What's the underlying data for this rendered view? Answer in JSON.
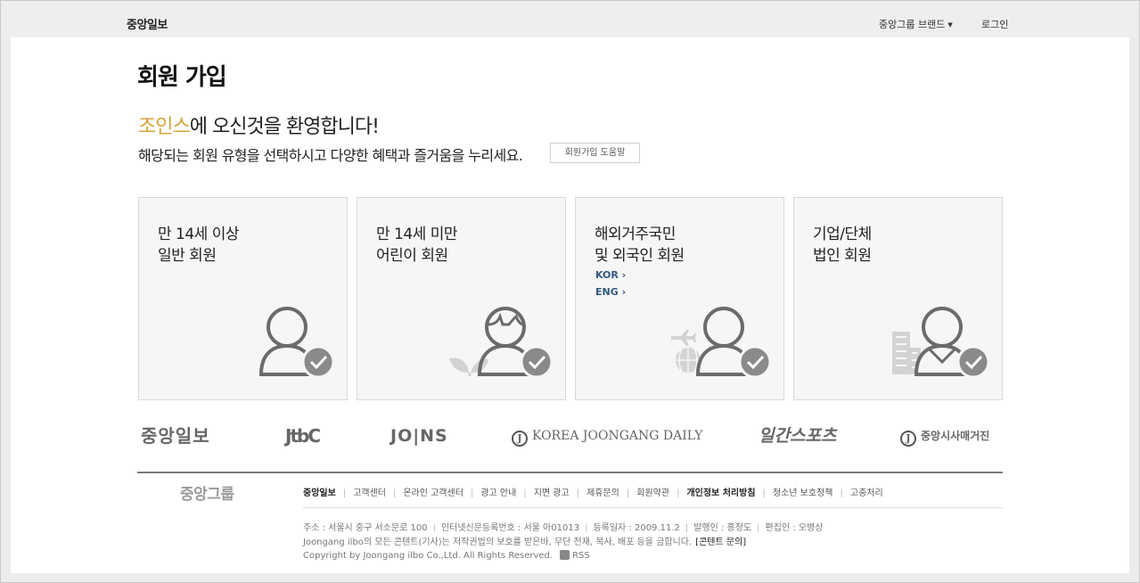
{
  "header": {
    "logo": "중앙일보",
    "brand_menu_label": "중앙그룹 브랜드",
    "login_label": "로그인"
  },
  "page": {
    "title": "회원 가입",
    "welcome_brand": "조인스",
    "welcome_rest": "에 오신것을 환영합니다!",
    "subtitle": "해당되는 회원 유형을 선택하시고 다양한 혜택과 즐거움을 누리세요.",
    "help_button": "회원가입 도움말"
  },
  "cards": [
    {
      "line1": "만 14세 이상",
      "line2": "일반 회원"
    },
    {
      "line1": "만 14세 미만",
      "line2": "어린이 회원"
    },
    {
      "line1": "해외거주국민",
      "line2": "및 외국인 회원",
      "links": [
        "KOR",
        "ENG"
      ]
    },
    {
      "line1": "기업/단체",
      "line2": "법인 회원"
    }
  ],
  "brands": {
    "joongang": "중앙일보",
    "jtbc": "JtbC",
    "joins": "JO|NS",
    "kjd": "KOREA JOONGANG DAILY",
    "kjd_mark": "J",
    "ilgan": "일간스포츠",
    "jsm": "중앙시사매거진",
    "jsm_mark": "J"
  },
  "footer": {
    "brand": "중앙그룹",
    "links": [
      "중앙일보",
      "고객센터",
      "온라인 고객센터",
      "광고 안내",
      "지면 광고",
      "제휴문의",
      "회원약관",
      "개인정보 처리방침",
      "청소년 보호정책",
      "고충처리"
    ],
    "info": [
      "주소 : 서울시 중구 서소문로 100",
      "인터넷신문등록번호 : 서울 아01013",
      "등록일자 : 2009.11.2",
      "발행인 : 홍정도",
      "편집인 : 오병상"
    ],
    "notice": "Joongang ilbo의 모든 콘텐트(기사)는 저작권법의 보호를 받은바, 무단 전재, 복사, 배포 등을 금합니다.",
    "contact": "[콘텐트 문의]",
    "copyright": "Copyright by Joongang ilbo Co.,Ltd. All Rights Reserved.",
    "rss": "RSS"
  },
  "colors": {
    "accent": "#d4a23b",
    "link_blue": "#33597f",
    "icon_gray": "#6b6b6b",
    "check_gray": "#8a8a8a"
  },
  "icons": [
    "person-icon",
    "check-circle-icon",
    "leaf-icon",
    "airplane-icon",
    "globe-icon",
    "building-icon",
    "rss-icon",
    "caret-down-icon"
  ]
}
